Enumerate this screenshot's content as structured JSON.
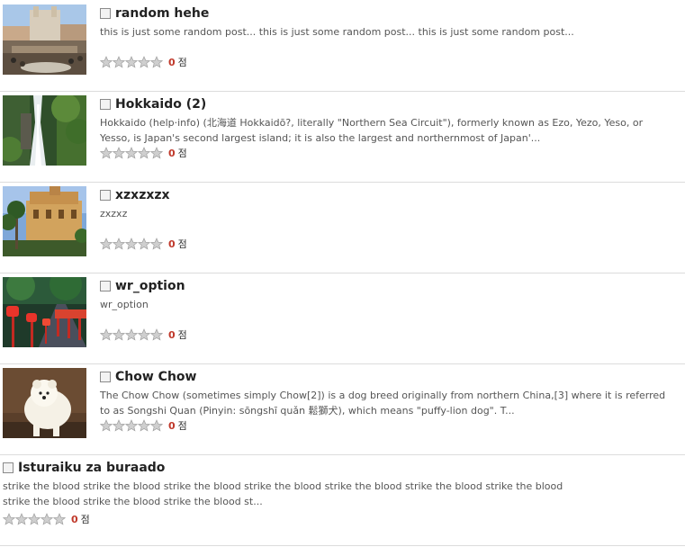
{
  "posts": [
    {
      "title": "random hehe",
      "summary": "this is just some random post... this is just some random post... this is just some random post...",
      "score": "0",
      "unit": "점",
      "stars_filled": 0,
      "thumbnail": "spanish-steps-photo"
    },
    {
      "title": "Hokkaido (2)",
      "summary": "Hokkaido (help·info) (北海道 Hokkaidō?, literally \"Northern Sea Circuit\"), formerly known as Ezo, Yezo, Yeso, or Yesso, is Japan's second largest island; it is also the largest and northernmost of Japan'...",
      "score": "0",
      "unit": "점",
      "stars_filled": 0,
      "thumbnail": "waterfall-forest-photo"
    },
    {
      "title": "xzxzxzx",
      "summary": "zxzxz",
      "score": "0",
      "unit": "점",
      "stars_filled": 0,
      "thumbnail": "building-palms-photo"
    },
    {
      "title": "wr_option",
      "summary": "wr_option",
      "score": "0",
      "unit": "점",
      "stars_filled": 0,
      "thumbnail": "red-lanterns-photo"
    },
    {
      "title": "Chow Chow",
      "summary": "The Chow Chow (sometimes simply Chow[2]) is a dog breed originally from northern China,[3] where it is referred to as Songshi Quan (Pinyin: sōngshī quǎn 鬆獅犬), which means \"puffy-lion dog\". T...",
      "score": "0",
      "unit": "점",
      "stars_filled": 0,
      "thumbnail": "chow-chow-dog-photo"
    },
    {
      "title": "Isturaiku za buraado",
      "summary": "strike the blood strike the blood strike the blood strike the blood strike the blood strike the blood strike the blood strike the blood strike the blood strike the blood st...",
      "score": "0",
      "unit": "점",
      "stars_filled": 0,
      "thumbnail": ""
    }
  ],
  "colors": {
    "score": "#c0392b",
    "star_empty": "#c8c8c8",
    "divider": "#dcdcdc"
  }
}
